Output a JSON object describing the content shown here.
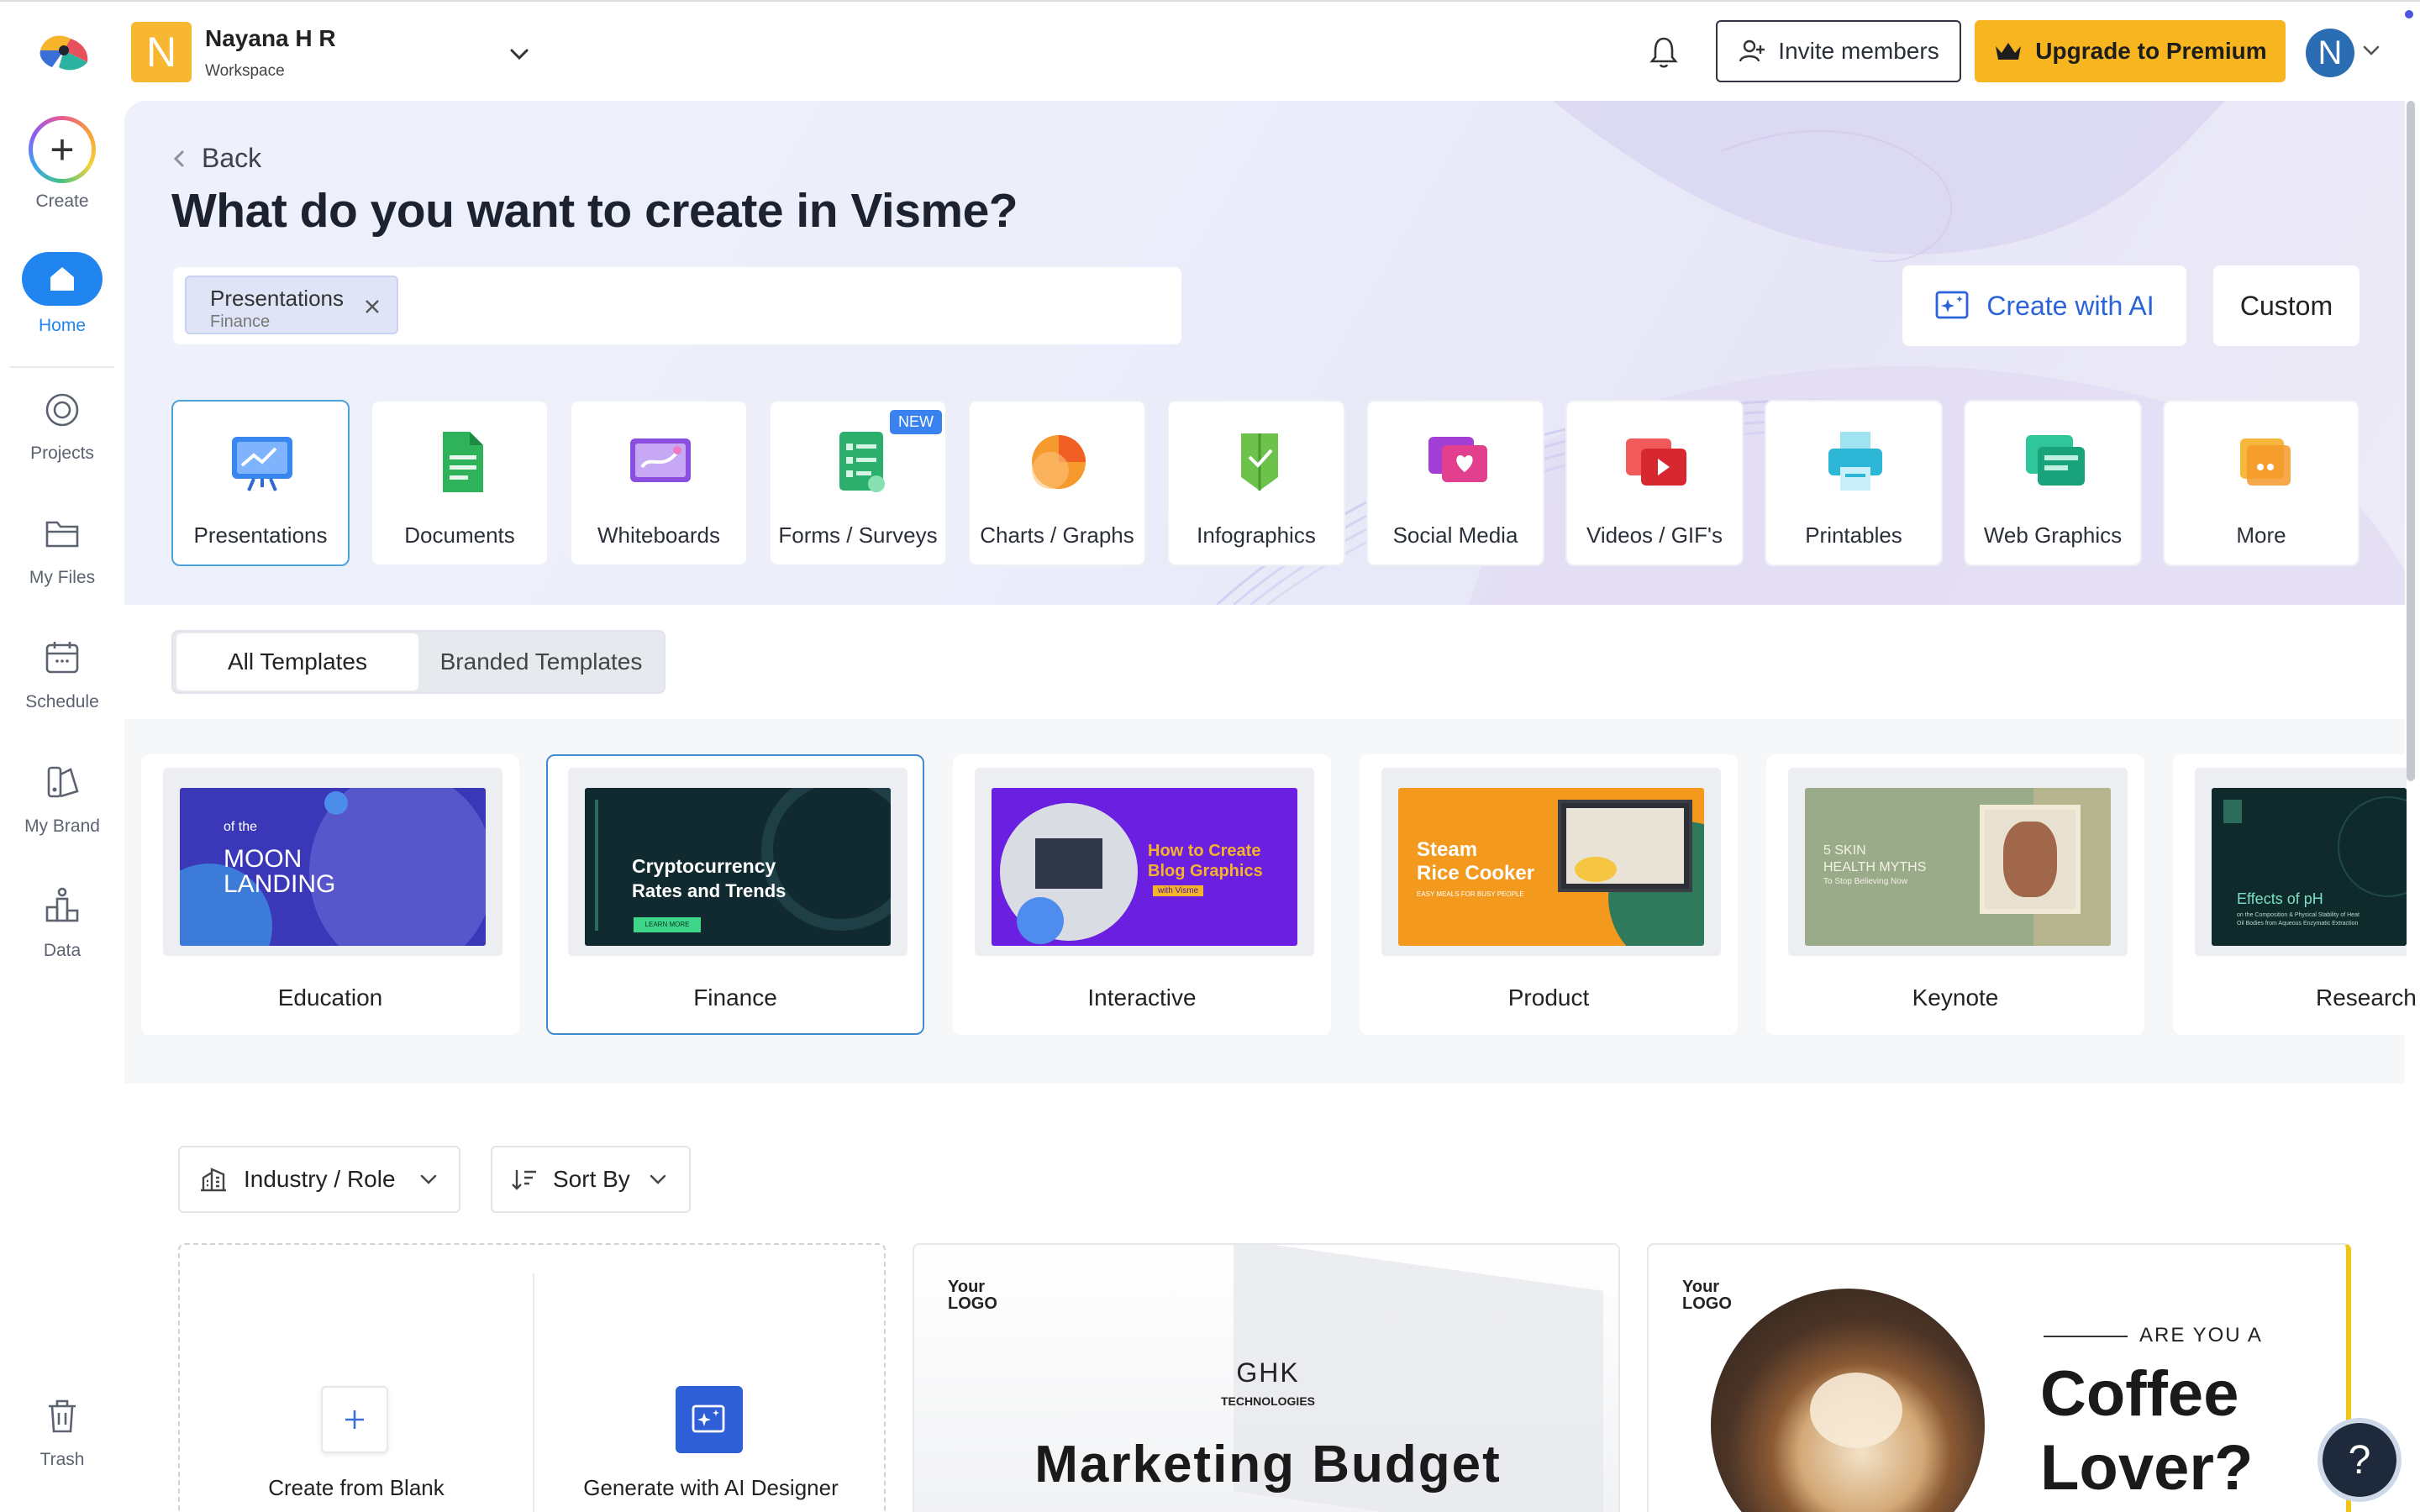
{
  "workspace": {
    "initial": "N",
    "name": "Nayana H R",
    "subtitle": "Workspace"
  },
  "header": {
    "invite_label": "Invite members",
    "upgrade_label": "Upgrade to Premium",
    "user_initial": "N"
  },
  "sidebar": {
    "items": [
      {
        "label": "Create",
        "icon": "plus-icon"
      },
      {
        "label": "Home",
        "icon": "home-icon"
      },
      {
        "label": "Projects",
        "icon": "projects-icon"
      },
      {
        "label": "My Files",
        "icon": "folder-icon"
      },
      {
        "label": "Schedule",
        "icon": "calendar-icon"
      },
      {
        "label": "My Brand",
        "icon": "brand-icon"
      },
      {
        "label": "Data",
        "icon": "data-icon"
      },
      {
        "label": "Trash",
        "icon": "trash-icon"
      }
    ]
  },
  "hero": {
    "back_label": "Back",
    "title": "What do you want to create in Visme?",
    "chip": {
      "main": "Presentations",
      "sub": "Finance"
    },
    "ai_button": "Create with AI",
    "custom_button": "Custom"
  },
  "categories": [
    {
      "label": "Presentations",
      "icon": "presentation-icon",
      "active": true
    },
    {
      "label": "Documents",
      "icon": "document-icon"
    },
    {
      "label": "Whiteboards",
      "icon": "whiteboard-icon"
    },
    {
      "label": "Forms / Surveys",
      "icon": "form-icon",
      "badge": "NEW"
    },
    {
      "label": "Charts / Graphs",
      "icon": "chart-icon"
    },
    {
      "label": "Infographics",
      "icon": "infographic-icon"
    },
    {
      "label": "Social Media",
      "icon": "social-icon"
    },
    {
      "label": "Videos / GIF's",
      "icon": "video-icon"
    },
    {
      "label": "Printables",
      "icon": "printer-icon"
    },
    {
      "label": "Web Graphics",
      "icon": "web-graphics-icon"
    },
    {
      "label": "More",
      "icon": "more-icon"
    }
  ],
  "tabs": {
    "all": "All Templates",
    "branded": "Branded Templates"
  },
  "subcategories": [
    {
      "label": "Education",
      "thumb_lines": [
        "of the",
        "MOON",
        "LANDING"
      ]
    },
    {
      "label": "Finance",
      "active": true,
      "thumb_lines": [
        "Cryptocurrency",
        "Rates and Trends",
        "LEARN MORE"
      ]
    },
    {
      "label": "Interactive",
      "thumb_lines": [
        "How to Create",
        "Blog Graphics",
        "with Visme"
      ]
    },
    {
      "label": "Product",
      "thumb_lines": [
        "Steam",
        "Rice Cooker",
        "EASY MEALS FOR BUSY PEOPLE"
      ]
    },
    {
      "label": "Keynote",
      "thumb_lines": [
        "5 SKIN",
        "HEALTH MYTHS",
        "To Stop Believing Now"
      ]
    },
    {
      "label": "Research",
      "thumb_lines": [
        "Effects of pH",
        "on the Composition & Physical Stability of Heat",
        "Oil Bodies from Aqueous Enzymatic Extraction"
      ]
    }
  ],
  "filters": {
    "industry": "Industry / Role",
    "sort": "Sort By"
  },
  "blank": {
    "create_blank": "Create from Blank",
    "generate_ai": "Generate with AI Designer"
  },
  "templates": [
    {
      "logo": "Your LOGO",
      "company": "GHK",
      "company_sub": "TECHNOLOGIES",
      "title": "Marketing Budget"
    },
    {
      "logo": "Your LOGO",
      "kicker": "ARE YOU A",
      "title_line1": "Coffee",
      "title_line2": "Lover?"
    }
  ],
  "help": {
    "label": "?"
  },
  "colors": {
    "accent_blue": "#2185f0",
    "upgrade_yellow": "#f7b520",
    "ai_blue": "#2b63d9"
  }
}
